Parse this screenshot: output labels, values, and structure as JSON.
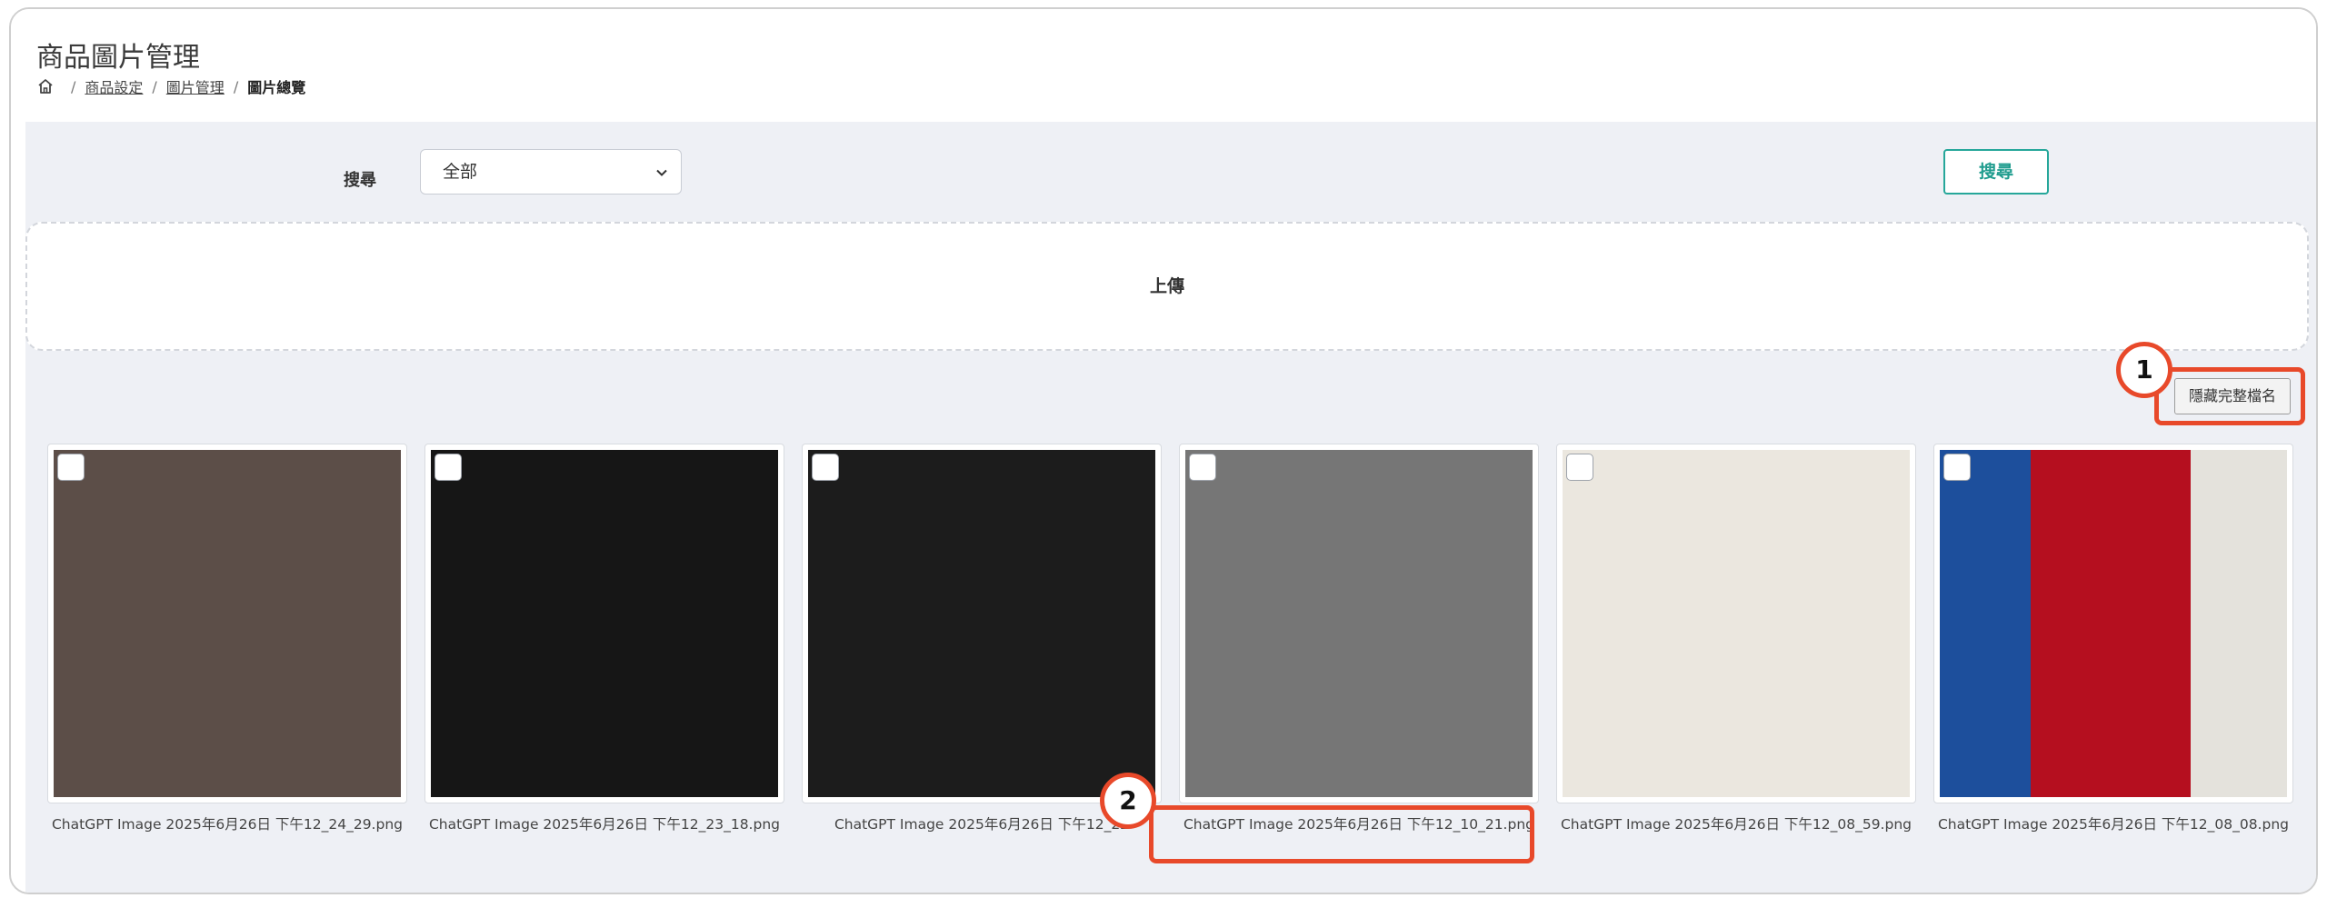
{
  "header": {
    "title": "商品圖片管理",
    "breadcrumb": [
      {
        "label": "商品設定",
        "link": true
      },
      {
        "label": "圖片管理",
        "link": true
      },
      {
        "label": "圖片總覽",
        "link": false
      }
    ],
    "separator": "/"
  },
  "search": {
    "label": "搜尋",
    "select_value": "全部",
    "button_label": "搜尋"
  },
  "upload": {
    "label": "上傳"
  },
  "toggle_filename": {
    "label": "隱藏完整檔名"
  },
  "annotations": [
    "1",
    "2"
  ],
  "images": [
    {
      "filename": "ChatGPT Image 2025年6月26日 下午12_24_29.png",
      "color": "#5c4e48"
    },
    {
      "filename": "ChatGPT Image 2025年6月26日 下午12_23_18.png",
      "color": "#161616"
    },
    {
      "filename": "ChatGPT Image 2025年6月26日 下午12_22",
      "color": "#1c1c1c"
    },
    {
      "filename": "ChatGPT Image 2025年6月26日 下午12_10_21.png",
      "color": "#767676"
    },
    {
      "filename": "ChatGPT Image 2025年6月26日 下午12_08_59.png",
      "color": "#ebe7df"
    },
    {
      "filename": "ChatGPT Image 2025年6月26日 下午12_08_08.png",
      "colors": [
        "#1d4f9c",
        "#b50f1f",
        "#e4e2dc"
      ]
    }
  ],
  "colors": {
    "accent_teal": "#26a79a",
    "highlight_red": "#e8492a",
    "content_bg": "#eef0f5"
  }
}
